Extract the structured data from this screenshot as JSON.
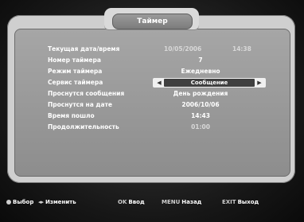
{
  "header": {
    "title": "Таймер"
  },
  "rows": [
    {
      "label": "Текущая дата/время",
      "value": "10/05/2006",
      "value2": "14:38"
    },
    {
      "label": "Номер таймера",
      "value": "7"
    },
    {
      "label": "Режим таймера",
      "value": "Ежедневно"
    },
    {
      "label": "Сервис таймера",
      "value": "Сообщение"
    },
    {
      "label": "Проснутся сообщения",
      "value": "День рождения"
    },
    {
      "label": "Проснутся на дате",
      "value": "2006/10/06"
    },
    {
      "label": "Время пошло",
      "value": "14:43"
    },
    {
      "label": "Продолжительность",
      "value": "01:00"
    }
  ],
  "footer": {
    "select": {
      "key": "",
      "label": "Выбор"
    },
    "change": {
      "key": "◂▸",
      "label": "Изменить"
    },
    "ok": {
      "key": "OK",
      "label": "Ввод"
    },
    "menu": {
      "key": "MENU",
      "label": "Назад"
    },
    "exit": {
      "key": "EXIT",
      "label": "Выход"
    }
  }
}
